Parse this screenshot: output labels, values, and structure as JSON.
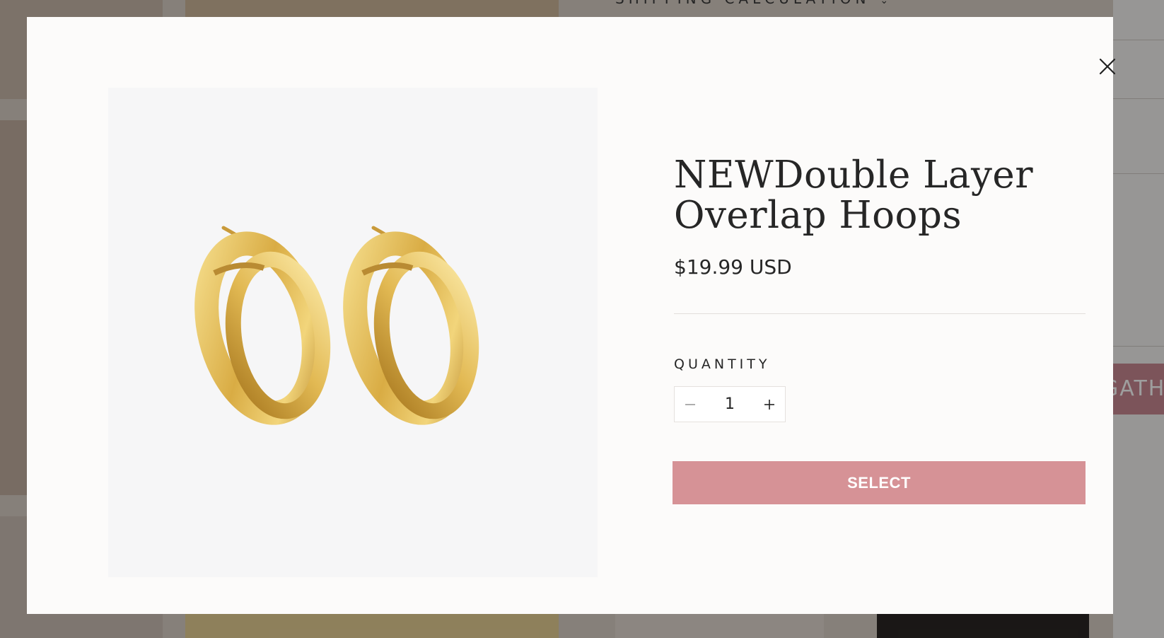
{
  "background": {
    "shipping_label": "SHIPPING CALCULATION",
    "side_button_text": "GATHER"
  },
  "modal": {
    "close_icon": "close-icon",
    "image_alt": "Double layer overlap gold hoop earrings",
    "product": {
      "title": "NEWDouble Layer Overlap Hoops",
      "price": "$19.99 USD"
    },
    "quantity": {
      "label": "QUANTITY",
      "value": "1",
      "decrease_icon": "minus-icon",
      "increase_icon": "plus-icon"
    },
    "select_label": "SELECT"
  },
  "colors": {
    "accent": "#d69296",
    "modal_bg": "#fcfbfa",
    "text": "#262626"
  }
}
